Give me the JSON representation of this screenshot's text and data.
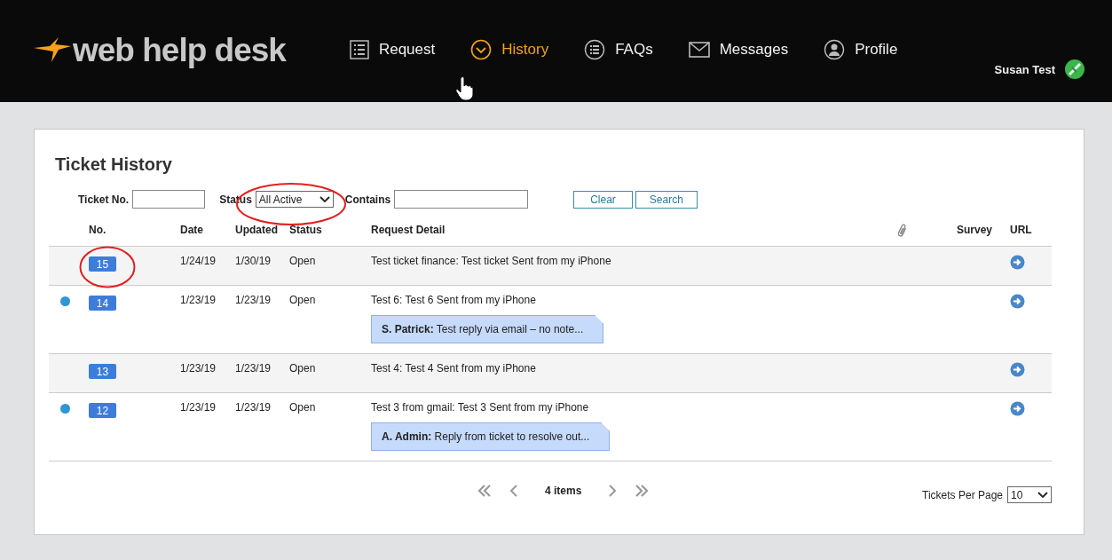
{
  "header": {
    "logo": "web help desk",
    "nav": [
      {
        "label": "Request",
        "selected": false
      },
      {
        "label": "History",
        "selected": true
      },
      {
        "label": "FAQs",
        "selected": false
      },
      {
        "label": "Messages",
        "selected": false
      },
      {
        "label": "Profile",
        "selected": false
      }
    ],
    "user": "Susan Test"
  },
  "page": {
    "title": "Ticket History",
    "filters": {
      "ticket_no": {
        "label": "Ticket No."
      },
      "status": {
        "label": "Status",
        "value": "All Active",
        "circled": true
      },
      "contains": {
        "label": "Contains"
      },
      "buttons": [
        "Clear",
        "Search"
      ]
    },
    "table": {
      "columns": [
        "No.",
        "Date",
        "Updated",
        "Status",
        "Request Detail",
        "Survey",
        "URL"
      ],
      "rows": [
        {
          "no": "15",
          "unread": false,
          "circled": true,
          "date": "1/24/19",
          "updated": "1/30/19",
          "status": "Open",
          "detail": "Test ticket finance: Test ticket Sent from my iPhone"
        },
        {
          "no": "14",
          "unread": true,
          "circled": false,
          "date": "1/23/19",
          "updated": "1/23/19",
          "status": "Open",
          "detail": "Test 6: Test 6 Sent from my iPhone",
          "note": {
            "author": "S. Patrick:",
            "text": "Test reply via email – no note..."
          }
        },
        {
          "no": "13",
          "unread": false,
          "circled": false,
          "date": "1/23/19",
          "updated": "1/23/19",
          "status": "Open",
          "detail": "Test 4: Test 4 Sent from my iPhone"
        },
        {
          "no": "12",
          "unread": true,
          "circled": false,
          "date": "1/23/19",
          "updated": "1/23/19",
          "status": "Open",
          "detail": "Test 3 from gmail: Test 3 Sent from my iPhone",
          "note": {
            "author": "A. Admin:",
            "text": "Reply from ticket to resolve out..."
          }
        }
      ]
    },
    "pager": {
      "count": "4 items",
      "per_page_label": "Tickets Per Page",
      "per_page": "10"
    }
  }
}
